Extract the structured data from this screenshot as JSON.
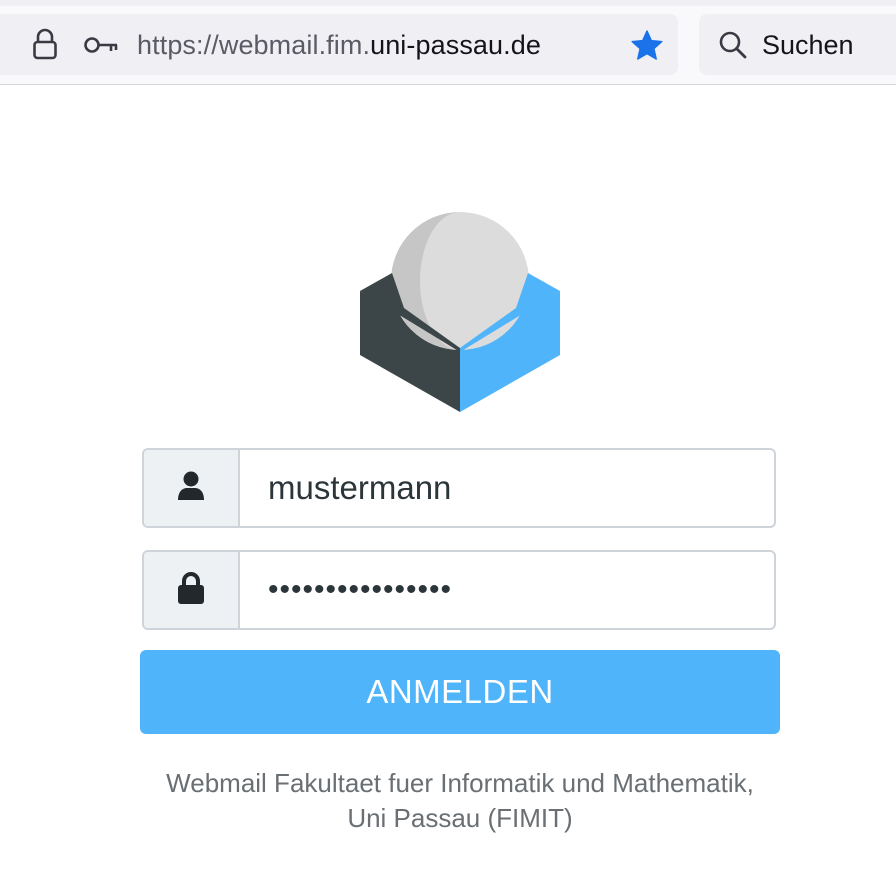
{
  "browser": {
    "url_prefix": "https://webmail.fim.",
    "url_domain": "uni-passau.de",
    "search_placeholder": "Suchen",
    "bookmark_star_color": "#1a73e8"
  },
  "logo": {
    "name": "roundcube-logo",
    "colors": {
      "dark": "#3c4548",
      "blue": "#4fb4f9",
      "ball": "#dcdcdc"
    }
  },
  "login": {
    "username_value": "mustermann",
    "password_value": "••••••••••••••••",
    "submit_label": "ANMELDEN"
  },
  "footer": {
    "line1": "Webmail Fakultaet fuer Informatik und Mathematik,",
    "line2": "Uni Passau (FIMIT)"
  }
}
